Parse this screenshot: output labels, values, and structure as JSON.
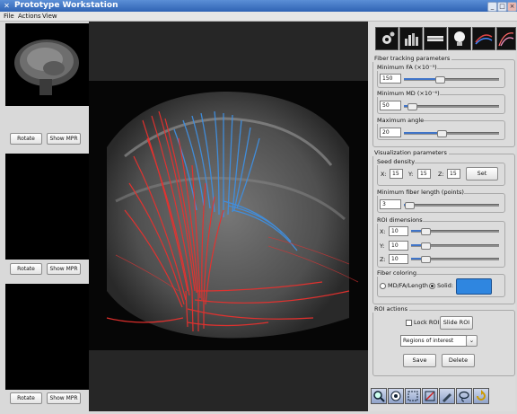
{
  "window": {
    "title": "Prototype Workstation",
    "controls": [
      "_",
      "□",
      "×"
    ]
  },
  "menu": [
    {
      "label": "File"
    },
    {
      "label": "Actions"
    },
    {
      "label": "View"
    }
  ],
  "left_panel": {
    "views": [
      {
        "rotate_label": "Rotate",
        "mpr_label": "Show MPR"
      },
      {
        "rotate_label": "Rotate",
        "mpr_label": "Show MPR"
      },
      {
        "rotate_label": "Rotate",
        "mpr_label": "Show MPR"
      }
    ]
  },
  "viewer": {
    "description": "3D fiber tracts rendered over brain MRI",
    "colors": {
      "primary_tract": "#e8312e",
      "secondary_tract": "#3f8fe0"
    }
  },
  "toolbar_icons": [
    "settings-icon",
    "histogram-icon",
    "slice-icon",
    "lightbulb-icon",
    "fibers-icon",
    "brain-fibers-icon"
  ],
  "fiber_tracking": {
    "title": "Fiber tracking parameters",
    "min_fa": {
      "label": "Minimum FA (×10⁻³)",
      "value": "150",
      "slider": 0.34
    },
    "min_md": {
      "label": "Minimum MD (×10⁻⁶)",
      "value": "50",
      "slider": 0.05
    },
    "max_angle": {
      "label": "Maximum angle",
      "value": "20",
      "slider": 0.36
    }
  },
  "visualization": {
    "title": "Visualization parameters",
    "seed_density": {
      "label": "Seed density",
      "x_label": "X:",
      "x": "15",
      "y_label": "Y:",
      "y": "15",
      "z_label": "Z:",
      "z": "15",
      "set_label": "Set"
    },
    "min_fiber_length": {
      "label": "Minimum fiber length (points)",
      "value": "3",
      "slider": 0.02
    },
    "roi_dimensions": {
      "label": "ROI dimensions",
      "x_label": "X:",
      "x": "10",
      "x_slider": 0.12,
      "y_label": "Y:",
      "y": "10",
      "y_slider": 0.12,
      "z_label": "Z:",
      "z": "10",
      "z_slider": 0.12
    },
    "fiber_coloring": {
      "label": "Fiber coloring",
      "option1": "MD/FA/Length",
      "option2": "Solid:",
      "selected": "Solid:",
      "solid_color": "#2f86e0"
    }
  },
  "roi_actions": {
    "title": "ROI actions",
    "lock_label": "Lock ROI",
    "slide_label": "Slide ROI",
    "dropdown_value": "Regions of interest",
    "save_label": "Save",
    "delete_label": "Delete"
  },
  "bottom_tools": [
    "zoom-icon",
    "pan-icon",
    "select-roi-icon",
    "delete-roi-icon",
    "brush-icon",
    "lasso-icon",
    "reset-icon"
  ]
}
